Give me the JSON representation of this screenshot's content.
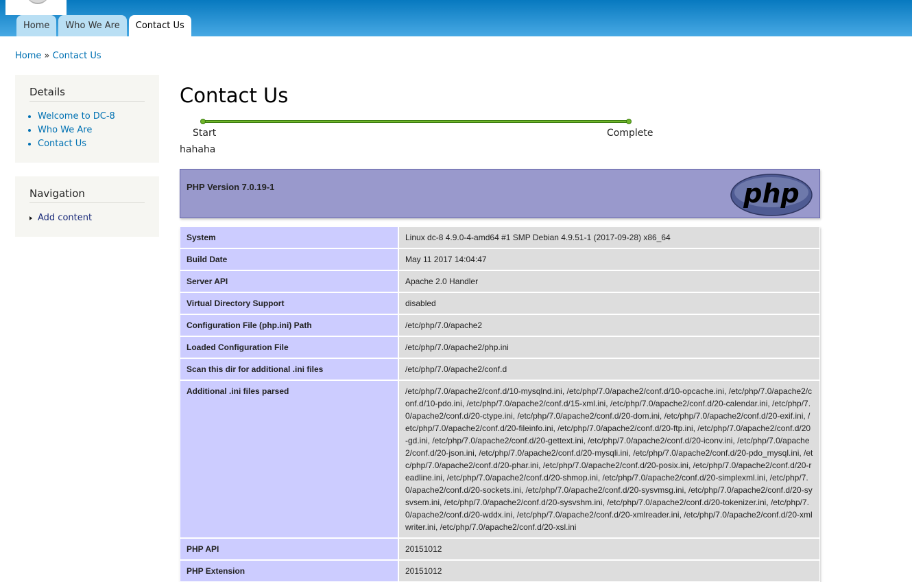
{
  "tabs": [
    {
      "label": "Home"
    },
    {
      "label": "Who We Are"
    },
    {
      "label": "Contact Us"
    }
  ],
  "breadcrumb": {
    "home": "Home",
    "separator": "»",
    "current": "Contact Us"
  },
  "sidebar": {
    "details": {
      "title": "Details",
      "items": [
        {
          "label": "Welcome to DC-8"
        },
        {
          "label": "Who We Are"
        },
        {
          "label": "Contact Us"
        }
      ]
    },
    "navigation": {
      "title": "Navigation",
      "items": [
        {
          "label": "Add content"
        }
      ]
    }
  },
  "main": {
    "title": "Contact Us",
    "progress": {
      "start_label": "Start",
      "end_label": "Complete",
      "fraction": 1.0
    },
    "body_text": "hahaha"
  },
  "phpinfo": {
    "header_title": "PHP Version 7.0.19-1",
    "logo_text": "php",
    "rows": [
      {
        "key": "System",
        "value": "Linux dc-8 4.9.0-4-amd64 #1 SMP Debian 4.9.51-1 (2017-09-28) x86_64"
      },
      {
        "key": "Build Date",
        "value": "May 11 2017 14:04:47"
      },
      {
        "key": "Server API",
        "value": "Apache 2.0 Handler"
      },
      {
        "key": "Virtual Directory Support",
        "value": "disabled"
      },
      {
        "key": "Configuration File (php.ini) Path",
        "value": "/etc/php/7.0/apache2"
      },
      {
        "key": "Loaded Configuration File",
        "value": "/etc/php/7.0/apache2/php.ini"
      },
      {
        "key": "Scan this dir for additional .ini files",
        "value": "/etc/php/7.0/apache2/conf.d"
      },
      {
        "key": "Additional .ini files parsed",
        "value": "/etc/php/7.0/apache2/conf.d/10-mysqlnd.ini, /etc/php/7.0/apache2/conf.d/10-opcache.ini, /etc/php/7.0/apache2/conf.d/10-pdo.ini, /etc/php/7.0/apache2/conf.d/15-xml.ini, /etc/php/7.0/apache2/conf.d/20-calendar.ini, /etc/php/7.0/apache2/conf.d/20-ctype.ini, /etc/php/7.0/apache2/conf.d/20-dom.ini, /etc/php/7.0/apache2/conf.d/20-exif.ini, /etc/php/7.0/apache2/conf.d/20-fileinfo.ini, /etc/php/7.0/apache2/conf.d/20-ftp.ini, /etc/php/7.0/apache2/conf.d/20-gd.ini, /etc/php/7.0/apache2/conf.d/20-gettext.ini, /etc/php/7.0/apache2/conf.d/20-iconv.ini, /etc/php/7.0/apache2/conf.d/20-json.ini, /etc/php/7.0/apache2/conf.d/20-mysqli.ini, /etc/php/7.0/apache2/conf.d/20-pdo_mysql.ini, /etc/php/7.0/apache2/conf.d/20-phar.ini, /etc/php/7.0/apache2/conf.d/20-posix.ini, /etc/php/7.0/apache2/conf.d/20-readline.ini, /etc/php/7.0/apache2/conf.d/20-shmop.ini, /etc/php/7.0/apache2/conf.d/20-simplexml.ini, /etc/php/7.0/apache2/conf.d/20-sockets.ini, /etc/php/7.0/apache2/conf.d/20-sysvmsg.ini, /etc/php/7.0/apache2/conf.d/20-sysvsem.ini, /etc/php/7.0/apache2/conf.d/20-sysvshm.ini, /etc/php/7.0/apache2/conf.d/20-tokenizer.ini, /etc/php/7.0/apache2/conf.d/20-wddx.ini, /etc/php/7.0/apache2/conf.d/20-xmlreader.ini, /etc/php/7.0/apache2/conf.d/20-xmlwriter.ini, /etc/php/7.0/apache2/conf.d/20-xsl.ini"
      },
      {
        "key": "PHP API",
        "value": "20151012"
      },
      {
        "key": "PHP Extension",
        "value": "20151012"
      }
    ]
  },
  "colors": {
    "header_top": "#0779bf",
    "header_bottom": "#48a9e4",
    "link": "#0071b3",
    "progress_green": "#70b52a",
    "php_header_bg": "#9999cc",
    "php_key_bg": "#ccccff",
    "php_value_bg": "#dddddd"
  }
}
